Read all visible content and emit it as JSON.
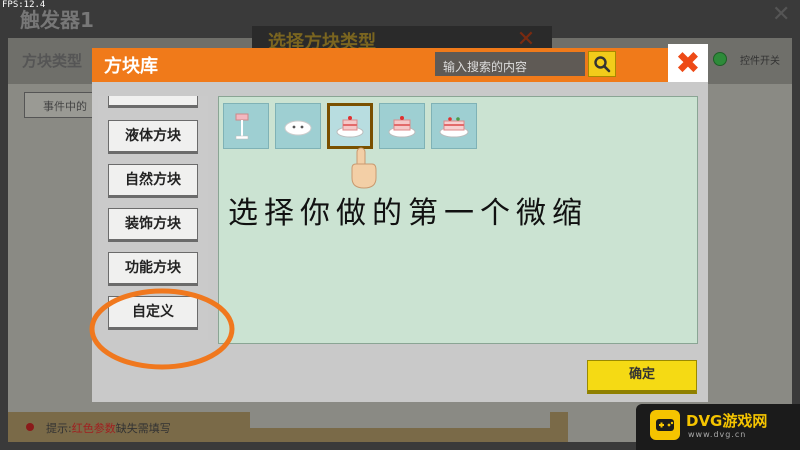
{
  "hud": {
    "fps": "FPS:12.4"
  },
  "background_window": {
    "title": "触发器1",
    "block_type_label": "方块类型",
    "event_button": "事件中的",
    "toggle_label": "控件开关",
    "tip_prefix": "提示:",
    "tip_red": "红色参数",
    "tip_suffix": "缺失需填写"
  },
  "select_window": {
    "title": "选择方块类型"
  },
  "dialog": {
    "title": "方块库",
    "search": {
      "placeholder": "输入搜索的内容"
    },
    "categories": [
      {
        "label": "液体方块"
      },
      {
        "label": "自然方块"
      },
      {
        "label": "装饰方块"
      },
      {
        "label": "功能方块"
      },
      {
        "label": "自定义"
      }
    ],
    "confirm_label": "确定"
  },
  "annotation": {
    "caption": "选择你做的第一个微缩"
  },
  "watermark": {
    "name": "DVG游戏网",
    "url": "www.dvg.cn"
  },
  "colors": {
    "accent_orange": "#f07a1a",
    "confirm_yellow": "#f5da14",
    "content_bg": "#cbe3d2",
    "annotation_circle": "#f0781e"
  }
}
